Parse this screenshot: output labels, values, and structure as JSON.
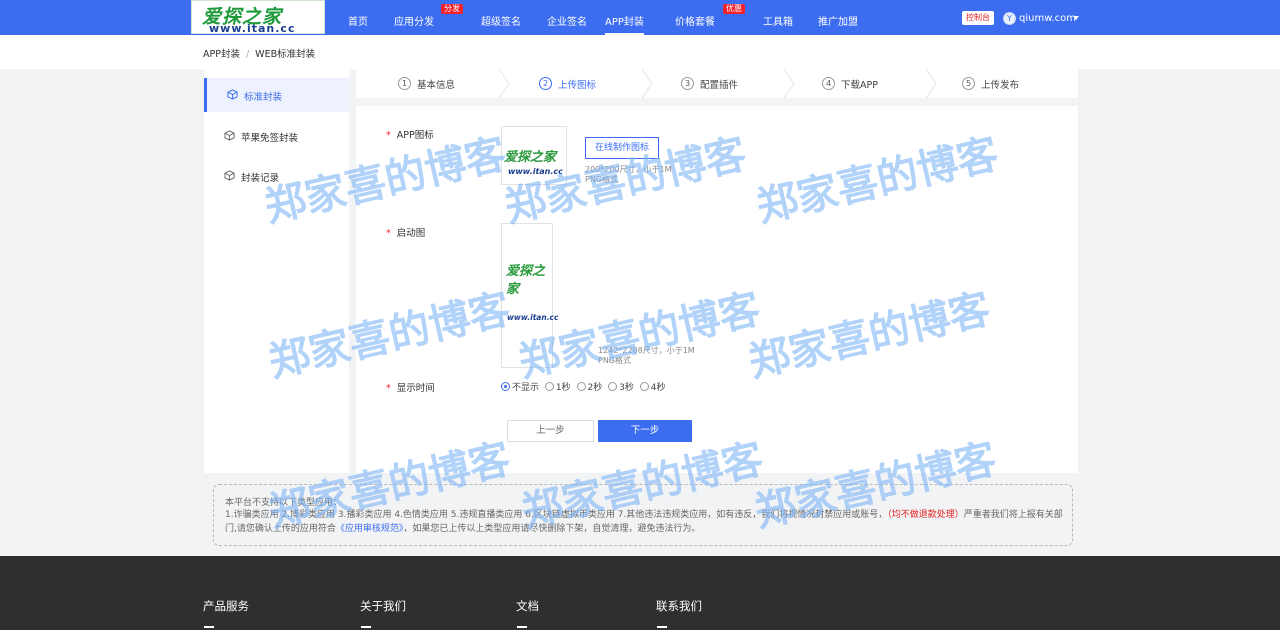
{
  "logo": {
    "line1": "爱探之家",
    "line2": "www.itan.cc"
  },
  "nav": {
    "items": [
      "首页",
      "应用分发",
      "超级签名",
      "企业签名",
      "APP封装",
      "价格套餐",
      "工具箱",
      "推广加盟"
    ],
    "badge_distribution": "分发",
    "badge_pricing": "优惠",
    "console": "控制台",
    "avatar_letter": "Y",
    "username": "qiumw.com"
  },
  "breadcrumb": {
    "root": "APP封装",
    "sep": "/",
    "current": "WEB标准封装"
  },
  "sidebar": {
    "items": [
      "标准封装",
      "苹果免签封装",
      "封装记录"
    ]
  },
  "steps": [
    {
      "num": "1",
      "label": "基本信息"
    },
    {
      "num": "2",
      "label": "上传图标"
    },
    {
      "num": "3",
      "label": "配置插件"
    },
    {
      "num": "4",
      "label": "下载APP"
    },
    {
      "num": "5",
      "label": "上传发布"
    }
  ],
  "form": {
    "app_icon_label": "APP图标",
    "required_mark": "*",
    "make_icon_button": "在线制作图标",
    "icon_hint_1": "200*200尺寸，小于1M",
    "icon_hint_2": "PNG格式",
    "splash_label": "启动图",
    "splash_hint_1": "1242*2208尺寸，小于1M",
    "splash_hint_2": "PNG格式",
    "display_time_label": "显示时间",
    "display_options": [
      "不显示",
      "1秒",
      "2秒",
      "3秒",
      "4秒"
    ],
    "prev_button": "上一步",
    "next_button": "下一步"
  },
  "notice": {
    "title": "本平台不支持以下类型应用：",
    "body_a": "1.诈骗类应用 2.博彩类应用 3.播彩类应用 4.色情类应用 5.违规直播类应用 6.区块链虚拟币类应用 7.其他违法违规类应用，如有违反，我们将视情况封禁应用或账号，",
    "body_red": "（均不做退款处理）",
    "body_b": "严重者我们将上报有关部门,请您确认上传的应用符合",
    "body_link": "《应用审核规范》",
    "body_c": "，如果您已上传以上类型应用请尽快删除下架，自觉清理，避免违法行为。"
  },
  "footer": {
    "columns": [
      "产品服务",
      "关于我们",
      "文档",
      "联系我们"
    ]
  },
  "watermark": "郑家喜的博客",
  "colors": {
    "primary": "#3c6df0",
    "danger": "#f5222d",
    "footer_bg": "#2f2f2f"
  }
}
